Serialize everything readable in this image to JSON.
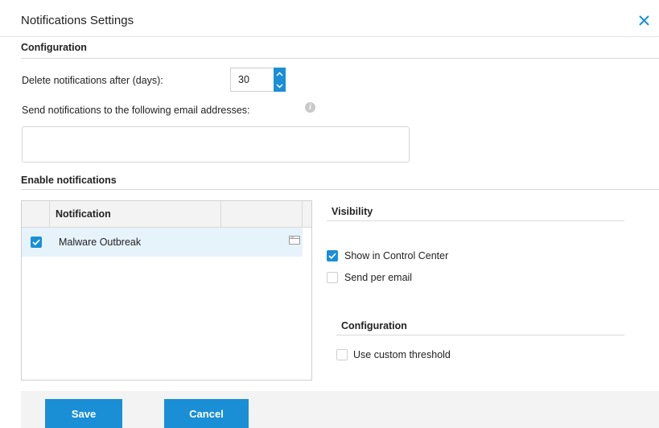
{
  "dialog": {
    "title": "Notifications Settings",
    "close_icon": "close-x-icon"
  },
  "configuration": {
    "heading": "Configuration",
    "delete_label": "Delete notifications after (days):",
    "delete_days": "30",
    "email_label": "Send notifications to the following email addresses:",
    "email_value": "",
    "info_icon": "info-icon"
  },
  "enable": {
    "heading": "Enable notifications",
    "column_header": "Notification",
    "rows": [
      {
        "label": "Malware Outbreak",
        "checked": true,
        "icon": "window-icon"
      }
    ]
  },
  "visibility": {
    "heading": "Visibility",
    "show_in_control_center": {
      "label": "Show in Control Center",
      "checked": true
    },
    "send_per_email": {
      "label": "Send per email",
      "checked": false
    }
  },
  "notification_config": {
    "heading": "Configuration",
    "use_custom_threshold": {
      "label": "Use custom threshold",
      "checked": false
    }
  },
  "buttons": {
    "save": "Save",
    "cancel": "Cancel"
  },
  "colors": {
    "accent": "#1a8fd6",
    "selected_row": "#e6f3fb"
  }
}
